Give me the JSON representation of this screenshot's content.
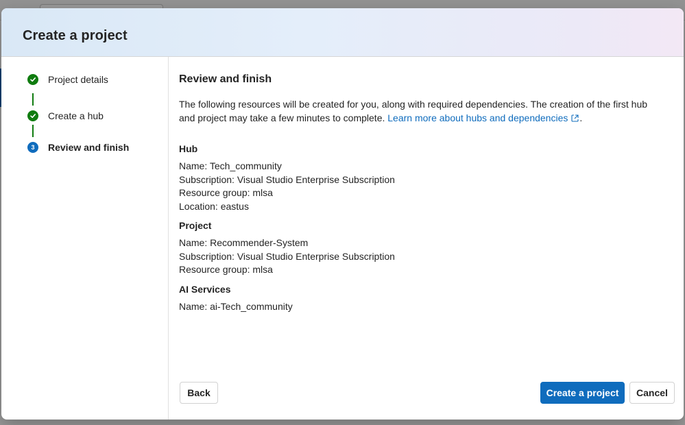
{
  "dialog": {
    "title": "Create a project"
  },
  "steps": [
    {
      "label": "Project details",
      "state": "done",
      "icon": "check-icon"
    },
    {
      "label": "Create a hub",
      "state": "done",
      "icon": "check-icon"
    },
    {
      "label": "Review and finish",
      "state": "current",
      "number": "3"
    }
  ],
  "review": {
    "title": "Review and finish",
    "intro": "The following resources will be created for you, along with required dependencies. The creation of the first hub and project may take a few minutes to complete.",
    "learn_more": "Learn more about hubs and dependencies",
    "intro_end": ".",
    "hub": {
      "title": "Hub",
      "lines": [
        "Name: Tech_community",
        "Subscription: Visual Studio Enterprise Subscription",
        "Resource group: mlsa",
        "Location: eastus"
      ]
    },
    "project": {
      "title": "Project",
      "lines": [
        "Name: Recommender-System",
        "Subscription: Visual Studio Enterprise Subscription",
        "Resource group: mlsa"
      ]
    },
    "ai_services": {
      "title": "AI Services",
      "lines": [
        "Name: ai-Tech_community"
      ]
    }
  },
  "buttons": {
    "back": "Back",
    "create": "Create a project",
    "cancel": "Cancel"
  },
  "colors": {
    "primary": "#0f6cbd",
    "success": "#107c10",
    "link": "#0f6cbd"
  }
}
